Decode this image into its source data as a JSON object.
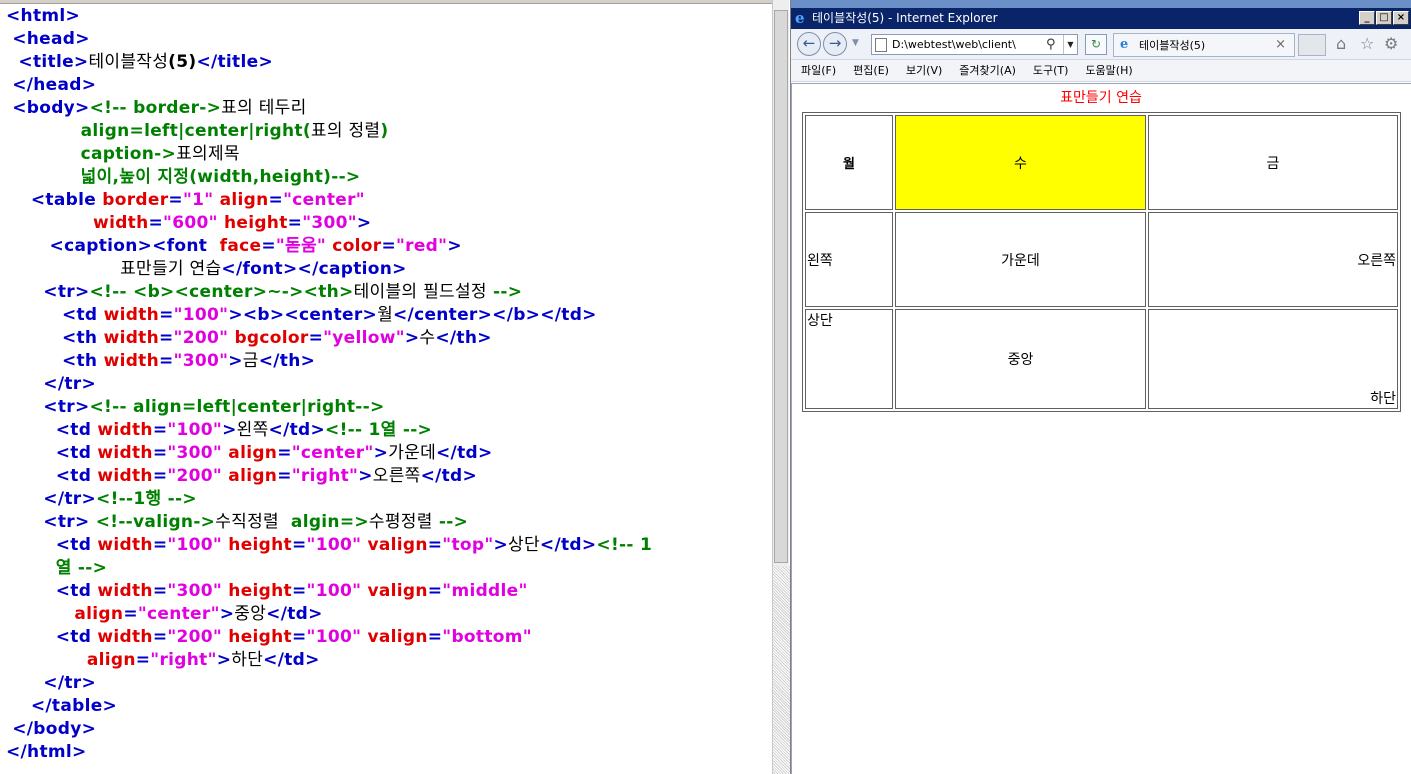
{
  "editor": {
    "code_lines": [
      [
        {
          "c": "k",
          "t": "<html>"
        }
      ],
      [
        {
          "c": "k",
          "t": " <head>"
        }
      ],
      [
        {
          "c": "k",
          "t": "  <title>"
        },
        {
          "c": "t",
          "t": "테이블작성"
        },
        {
          "c": "tb",
          "t": "(5)"
        },
        {
          "c": "k",
          "t": "</title>"
        }
      ],
      [
        {
          "c": "k",
          "t": " </head>"
        }
      ],
      [
        {
          "c": "k",
          "t": " <body>"
        },
        {
          "c": "c",
          "t": "<!-- border->"
        },
        {
          "c": "t",
          "t": "표의 테두리"
        }
      ],
      [
        {
          "c": "c",
          "t": "            align=left|center|right("
        },
        {
          "c": "t",
          "t": "표의 정렬"
        },
        {
          "c": "c",
          "t": ")"
        }
      ],
      [
        {
          "c": "c",
          "t": "            caption->"
        },
        {
          "c": "t",
          "t": "표의제목"
        }
      ],
      [
        {
          "c": "c",
          "t": "            넓이,높이 지정(width,height)-->"
        }
      ],
      [
        {
          "c": "k",
          "t": "    <table "
        },
        {
          "c": "a",
          "t": "border"
        },
        {
          "c": "k",
          "t": "="
        },
        {
          "c": "v",
          "t": "\"1\""
        },
        {
          "c": "a",
          "t": " align"
        },
        {
          "c": "k",
          "t": "="
        },
        {
          "c": "v",
          "t": "\"center\""
        }
      ],
      [
        {
          "c": "a",
          "t": "              width"
        },
        {
          "c": "k",
          "t": "="
        },
        {
          "c": "v",
          "t": "\"600\""
        },
        {
          "c": "a",
          "t": " height"
        },
        {
          "c": "k",
          "t": "="
        },
        {
          "c": "v",
          "t": "\"300\""
        },
        {
          "c": "k",
          "t": ">"
        }
      ],
      [
        {
          "c": "k",
          "t": "       <caption><font "
        },
        {
          "c": "a",
          "t": " face"
        },
        {
          "c": "k",
          "t": "="
        },
        {
          "c": "v",
          "t": "\"돋움\""
        },
        {
          "c": "a",
          "t": " color"
        },
        {
          "c": "k",
          "t": "="
        },
        {
          "c": "v",
          "t": "\"red\""
        },
        {
          "c": "k",
          "t": ">"
        }
      ],
      [
        {
          "c": "t",
          "t": "                    표만들기 연습"
        },
        {
          "c": "k",
          "t": "</font></caption>"
        }
      ],
      [
        {
          "c": "k",
          "t": "      <tr>"
        },
        {
          "c": "c",
          "t": "<!-- <b><center>~-><th>"
        },
        {
          "c": "t",
          "t": "테이블의 필드설정"
        },
        {
          "c": "c",
          "t": " -->"
        }
      ],
      [
        {
          "c": "k",
          "t": "         <td "
        },
        {
          "c": "a",
          "t": "width"
        },
        {
          "c": "k",
          "t": "="
        },
        {
          "c": "v",
          "t": "\"100\""
        },
        {
          "c": "k",
          "t": "><b><center>"
        },
        {
          "c": "t",
          "t": "월"
        },
        {
          "c": "k",
          "t": "</center></b></td>"
        }
      ],
      [
        {
          "c": "k",
          "t": "         <th "
        },
        {
          "c": "a",
          "t": "width"
        },
        {
          "c": "k",
          "t": "="
        },
        {
          "c": "v",
          "t": "\"200\""
        },
        {
          "c": "a",
          "t": " bgcolor"
        },
        {
          "c": "k",
          "t": "="
        },
        {
          "c": "v",
          "t": "\"yellow\""
        },
        {
          "c": "k",
          "t": ">"
        },
        {
          "c": "t",
          "t": "수"
        },
        {
          "c": "k",
          "t": "</th>"
        }
      ],
      [
        {
          "c": "k",
          "t": "         <th "
        },
        {
          "c": "a",
          "t": "width"
        },
        {
          "c": "k",
          "t": "="
        },
        {
          "c": "v",
          "t": "\"300\""
        },
        {
          "c": "k",
          "t": ">"
        },
        {
          "c": "t",
          "t": "금"
        },
        {
          "c": "k",
          "t": "</th>"
        }
      ],
      [
        {
          "c": "k",
          "t": "      </tr>"
        }
      ],
      [
        {
          "c": "k",
          "t": "      <tr>"
        },
        {
          "c": "c",
          "t": "<!-- align=left|center|right-->"
        }
      ],
      [
        {
          "c": "k",
          "t": "        <td "
        },
        {
          "c": "a",
          "t": "width"
        },
        {
          "c": "k",
          "t": "="
        },
        {
          "c": "v",
          "t": "\"100\""
        },
        {
          "c": "k",
          "t": ">"
        },
        {
          "c": "t",
          "t": "왼쪽"
        },
        {
          "c": "k",
          "t": "</td>"
        },
        {
          "c": "c",
          "t": "<!-- 1열 -->"
        }
      ],
      [
        {
          "c": "k",
          "t": "        <td "
        },
        {
          "c": "a",
          "t": "width"
        },
        {
          "c": "k",
          "t": "="
        },
        {
          "c": "v",
          "t": "\"300\""
        },
        {
          "c": "a",
          "t": " align"
        },
        {
          "c": "k",
          "t": "="
        },
        {
          "c": "v",
          "t": "\"center\""
        },
        {
          "c": "k",
          "t": ">"
        },
        {
          "c": "t",
          "t": "가운데"
        },
        {
          "c": "k",
          "t": "</td>"
        }
      ],
      [
        {
          "c": "k",
          "t": "        <td "
        },
        {
          "c": "a",
          "t": "width"
        },
        {
          "c": "k",
          "t": "="
        },
        {
          "c": "v",
          "t": "\"200\""
        },
        {
          "c": "a",
          "t": " align"
        },
        {
          "c": "k",
          "t": "="
        },
        {
          "c": "v",
          "t": "\"right\""
        },
        {
          "c": "k",
          "t": ">"
        },
        {
          "c": "t",
          "t": "오른쪽"
        },
        {
          "c": "k",
          "t": "</td>"
        }
      ],
      [
        {
          "c": "k",
          "t": "      </tr>"
        },
        {
          "c": "c",
          "t": "<!--1행 -->"
        }
      ],
      [
        {
          "c": "k",
          "t": "      <tr> "
        },
        {
          "c": "c",
          "t": "<!--valign->"
        },
        {
          "c": "t",
          "t": "수직정렬 "
        },
        {
          "c": "c",
          "t": " algin=>"
        },
        {
          "c": "t",
          "t": "수평정렬"
        },
        {
          "c": "c",
          "t": " -->"
        }
      ],
      [
        {
          "c": "k",
          "t": "        <td "
        },
        {
          "c": "a",
          "t": "width"
        },
        {
          "c": "k",
          "t": "="
        },
        {
          "c": "v",
          "t": "\"100\""
        },
        {
          "c": "a",
          "t": " height"
        },
        {
          "c": "k",
          "t": "="
        },
        {
          "c": "v",
          "t": "\"100\""
        },
        {
          "c": "a",
          "t": " valign"
        },
        {
          "c": "k",
          "t": "="
        },
        {
          "c": "v",
          "t": "\"top\""
        },
        {
          "c": "k",
          "t": ">"
        },
        {
          "c": "t",
          "t": "상단"
        },
        {
          "c": "k",
          "t": "</td>"
        },
        {
          "c": "c",
          "t": "<!-- 1"
        }
      ],
      [
        {
          "c": "c",
          "t": "        열 -->"
        }
      ],
      [
        {
          "c": "k",
          "t": "        <td "
        },
        {
          "c": "a",
          "t": "width"
        },
        {
          "c": "k",
          "t": "="
        },
        {
          "c": "v",
          "t": "\"300\""
        },
        {
          "c": "a",
          "t": " height"
        },
        {
          "c": "k",
          "t": "="
        },
        {
          "c": "v",
          "t": "\"100\""
        },
        {
          "c": "a",
          "t": " valign"
        },
        {
          "c": "k",
          "t": "="
        },
        {
          "c": "v",
          "t": "\"middle\""
        }
      ],
      [
        {
          "c": "a",
          "t": "           align"
        },
        {
          "c": "k",
          "t": "="
        },
        {
          "c": "v",
          "t": "\"center\""
        },
        {
          "c": "k",
          "t": ">"
        },
        {
          "c": "t",
          "t": "중앙"
        },
        {
          "c": "k",
          "t": "</td>"
        }
      ],
      [
        {
          "c": "k",
          "t": "        <td "
        },
        {
          "c": "a",
          "t": "width"
        },
        {
          "c": "k",
          "t": "="
        },
        {
          "c": "v",
          "t": "\"200\""
        },
        {
          "c": "a",
          "t": " height"
        },
        {
          "c": "k",
          "t": "="
        },
        {
          "c": "v",
          "t": "\"100\""
        },
        {
          "c": "a",
          "t": " valign"
        },
        {
          "c": "k",
          "t": "="
        },
        {
          "c": "v",
          "t": "\"bottom\""
        }
      ],
      [
        {
          "c": "a",
          "t": "             align"
        },
        {
          "c": "k",
          "t": "="
        },
        {
          "c": "v",
          "t": "\"right\""
        },
        {
          "c": "k",
          "t": ">"
        },
        {
          "c": "t",
          "t": "하단"
        },
        {
          "c": "k",
          "t": "</td>"
        }
      ],
      [
        {
          "c": "k",
          "t": "      </tr>"
        }
      ],
      [
        {
          "c": "k",
          "t": "    </table>"
        }
      ],
      [
        {
          "c": "k",
          "t": " </body>"
        }
      ],
      [
        {
          "c": "k",
          "t": "</html>"
        }
      ]
    ],
    "colors": {
      "tag": "#0000c8",
      "attr": "#e00000",
      "value": "#e000e0",
      "comment": "#008000",
      "text": "#000000"
    }
  },
  "browser": {
    "window_title": "테이블작성(5) - Internet Explorer",
    "window_buttons": {
      "minimize": "_",
      "maximize": "□",
      "close": "×"
    },
    "address": "D:\\webtest\\web\\client\\",
    "tab_label": "테이블작성(5)",
    "menu": [
      "파일(F)",
      "편집(E)",
      "보기(V)",
      "즐겨찾기(A)",
      "도구(T)",
      "도움말(H)"
    ],
    "icons": [
      "back-icon",
      "forward-icon",
      "refresh-icon",
      "home-icon",
      "favorites-star-icon",
      "settings-gear-icon"
    ]
  },
  "page": {
    "caption": "표만들기 연습",
    "caption_color": "#ff0000",
    "header_row": {
      "mon": "월",
      "wed": "수",
      "fri": "금"
    },
    "row2": {
      "left": "왼쪽",
      "center": "가운데",
      "right": "오른쪽"
    },
    "row3": {
      "top": "상단",
      "middle": "중앙",
      "bottom": "하단"
    },
    "highlight_color": "#ffff00"
  }
}
